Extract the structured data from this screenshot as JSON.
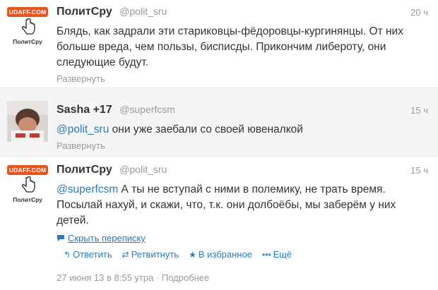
{
  "tweets": [
    {
      "name": "ПолитСру",
      "handle": "@polit_sru",
      "time": "20 ч",
      "text": "Блядь, как задрали эти стариковцы-фёдоровцы-кургинянцы. От них больше вреда, чем пользы, бисписды. Прикончим либероту, они следующие будут.",
      "expand": "Развернуть",
      "logo_text": "UDAFF.COM",
      "logo_name": "ПолитСру"
    },
    {
      "name": "Sasha +17",
      "handle": "@superfcsm",
      "time": "15 ч",
      "mention": "@polit_sru",
      "text": " они уже заебали со своей ювеналкой",
      "expand": "Развернуть"
    },
    {
      "name": "ПолитСру",
      "handle": "@polit_sru",
      "time": "15 ч",
      "mention": "@superfcsm",
      "text": " А ты не вступай с ними в полемику, не трать время. Посылай нахуй, и скажи, что, т.к. они долбоёбы, мы заберём у них детей.",
      "hide_conversation": "Скрыть переписку",
      "actions": {
        "reply": "Ответить",
        "retweet": "Ретвитнуть",
        "favorite": "В избранное",
        "more": "Ещё"
      },
      "meta": "27 июня 13 в 8:55 утра · Подробнее",
      "logo_text": "UDAFF.COM",
      "logo_name": "ПолитСру"
    }
  ],
  "colors": {
    "link": "#2b7bb9",
    "logo_bg": "#e8531e",
    "muted": "#999999"
  }
}
